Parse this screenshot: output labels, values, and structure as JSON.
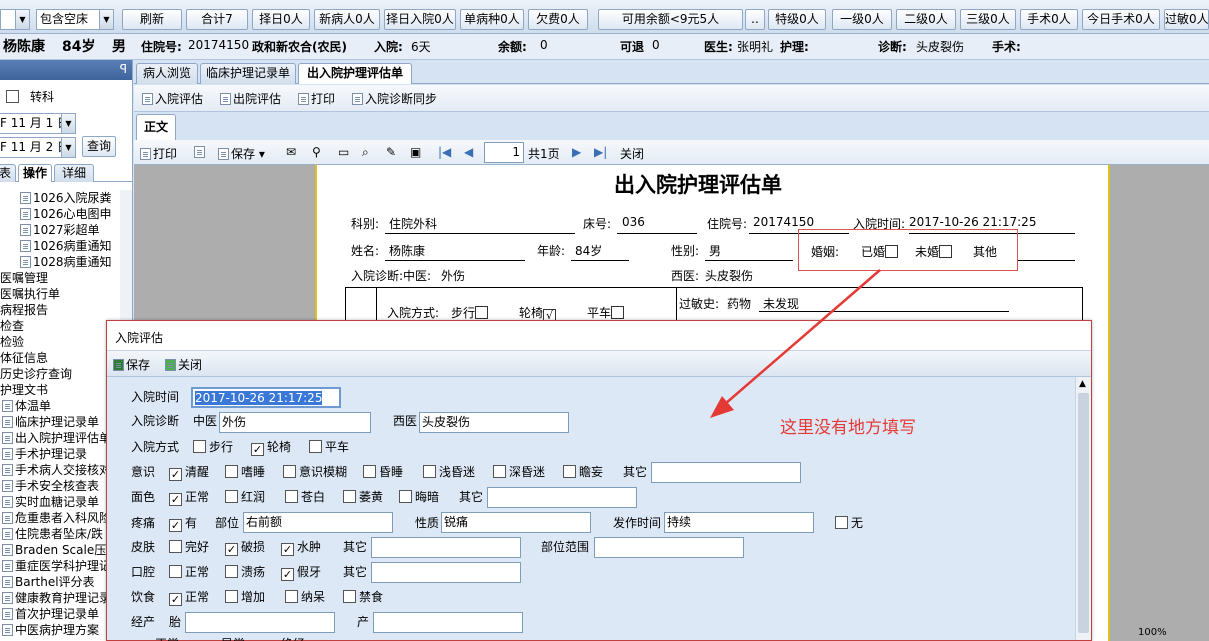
{
  "topbar": {
    "combo1": "包含空床",
    "buttons": [
      "刷新",
      "合计7",
      "择日0人",
      "新病人0人",
      "择日入院0人",
      "单病种0人",
      "欠费0人",
      "可用余额<9元5人",
      "..",
      "特级0人",
      "一级0人",
      "二级0人",
      "三级0人",
      "手术0人",
      "今日手术0人",
      "过敏0人"
    ]
  },
  "patient": {
    "name": "杨陈康",
    "age": "84岁",
    "sex": "男",
    "id_label": "住院号:",
    "id": "20174150",
    "insurance": "政和新农合(农民)",
    "admit_label": "入院:",
    "admit": "6天",
    "balance_label": "余额:",
    "balance": "0",
    "refund_label": "可退",
    "refund": "0",
    "doctor_label": "医生:",
    "doctor": "张明礼",
    "nurse_label": "护理:",
    "diag_label": "诊断:",
    "diag": "头皮裂伤",
    "surgery_label": "手术:"
  },
  "left": {
    "pin": "ꟼ",
    "transfer": "转科",
    "date1": "F 11 月 1 日",
    "date2": "F 11 月 2 日",
    "query": "查询",
    "tabs": [
      "表",
      "操作",
      "详细"
    ],
    "tree_top": [
      "1026入院尿粪",
      "1026心电图申",
      "1027彩超单",
      "1026病重通知",
      "1028病重通知"
    ],
    "menu": [
      "医嘱管理",
      "医嘱执行单",
      "病程报告",
      "检查",
      "检验",
      "体征信息",
      "历史诊疗查询",
      "护理文书"
    ],
    "docs": [
      "体温单",
      "临床护理记录单",
      "出入院护理评估单",
      "手术护理记录",
      "手术病人交接核对",
      "手术安全核查表",
      "实时血糖记录单",
      "危重患者入科风险",
      "住院患者坠床/跌",
      "Braden Scale压疮",
      "重症医学科护理记",
      "Barthel评分表",
      "健康教育护理记录",
      "首次护理记录单",
      "中医病护理方案"
    ]
  },
  "tabs": [
    "病人浏览",
    "临床护理记录单",
    "出入院护理评估单"
  ],
  "subtool": [
    "入院评估",
    "出院评估",
    "打印",
    "入院诊断同步"
  ],
  "zhengwen": "正文",
  "rpttool": {
    "print": "打印",
    "save": "保存",
    "page": "1",
    "pages": "共1页",
    "close": "关闭"
  },
  "paper": {
    "title": "出入院护理评估单",
    "dept_label": "科别:",
    "dept": "住院外科",
    "bed_label": "床号:",
    "bed": "036",
    "id_label": "住院号:",
    "id": "20174150",
    "time_label": "入院时间:",
    "time": "2017-10-26 21:17:25",
    "name_label": "姓名:",
    "name": "杨陈康",
    "age_label": "年龄:",
    "age": "84岁",
    "sex_label": "性别:",
    "sex": "男",
    "marriage_label": "婚姻:",
    "married": "已婚",
    "unmarried": "未婚",
    "other": "其他",
    "diag_label": "入院诊断:中医:",
    "diag_tcm": "外伤",
    "wdiag_label": "西医:",
    "wdiag": "头皮裂伤",
    "way_label": "入院方式:",
    "walk": "步行",
    "wheel": "轮椅",
    "cart": "平车",
    "allergy_label": "过敏史:",
    "drug": "药物",
    "allergy": "未发现"
  },
  "dialog": {
    "title": "入院评估",
    "save": "保存",
    "close": "关闭",
    "time_label": "入院时间",
    "time": "2017-10-26 21:17:25",
    "diag_label": "入院诊断",
    "tcm_label": "中医",
    "tcm": "外伤",
    "west_label": "西医",
    "west": "头皮裂伤",
    "way_label": "入院方式",
    "way": [
      "步行",
      "轮椅",
      "平车"
    ],
    "consc_label": "意识",
    "consc": [
      "清醒",
      "嗜睡",
      "意识模糊",
      "昏睡",
      "浅昏迷",
      "深昏迷",
      "瞻妄"
    ],
    "other": "其它",
    "face_label": "面色",
    "face": [
      "正常",
      "红润",
      "苍白",
      "萎黄",
      "晦暗"
    ],
    "pain_label": "疼痛",
    "pain_yes": "有",
    "pain_site_label": "部位",
    "pain_site": "右前额",
    "pain_nature_label": "性质",
    "pain_nature": "锐痛",
    "pain_time_label": "发作时间",
    "pain_time": "持续",
    "pain_no": "无",
    "skin_label": "皮肤",
    "skin": [
      "完好",
      "破损",
      "水肿"
    ],
    "skin_range_label": "部位范围",
    "mouth_label": "口腔",
    "mouth": [
      "正常",
      "溃疡",
      "假牙"
    ],
    "diet_label": "饮食",
    "diet": [
      "正常",
      "增加",
      "纳呆",
      "禁食"
    ],
    "mens_label": "经产",
    "mens_a": "胎",
    "mens_b": "产",
    "last_row": [
      "正常",
      "异常",
      "绝经"
    ]
  },
  "annotation": "这里没有地方填写",
  "status": "100%"
}
